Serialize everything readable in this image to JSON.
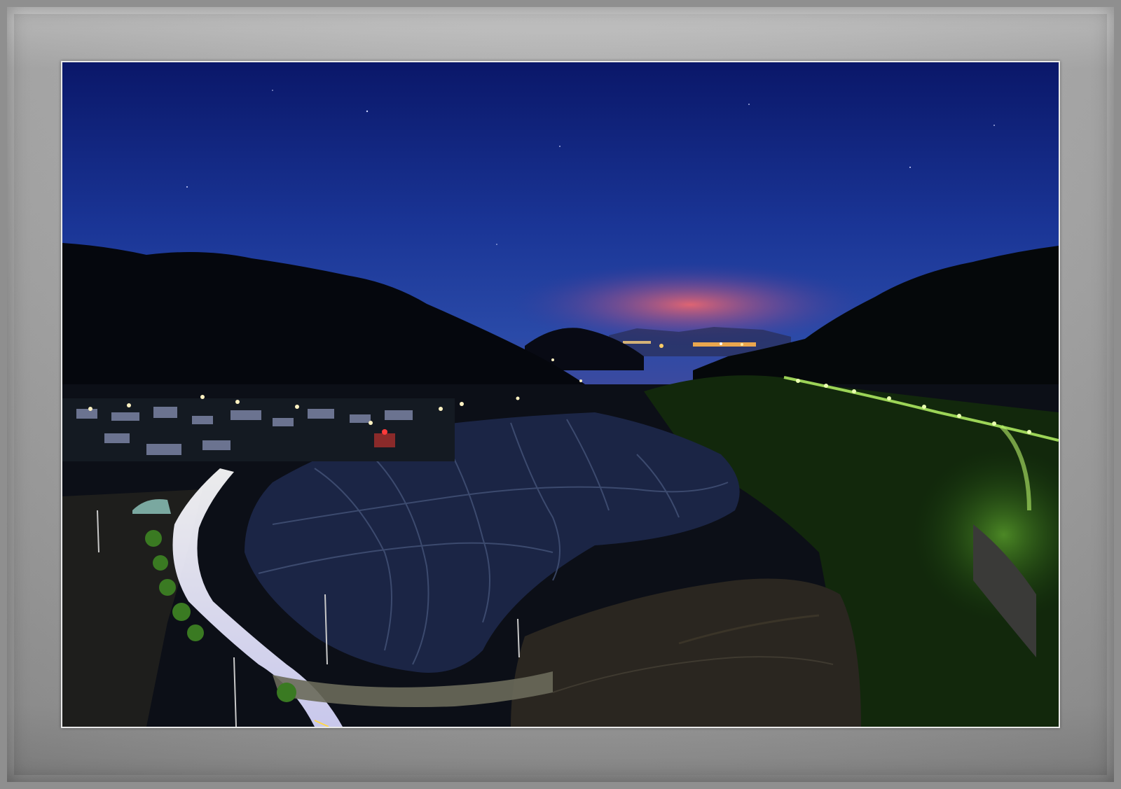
{
  "frame": {
    "outer_color": "#8f8f8f",
    "mat_color": "#a8a8a8",
    "border_color": "#e9e9e9"
  },
  "photo": {
    "sky_top": "#0b1a6e",
    "sky_mid": "#1d3d9e",
    "sky_horizon": "#6a5a9a",
    "glow_color": "#ff7a7a",
    "mountain_color": "#05070d",
    "field_color": "#1b2540",
    "road_light_color": "#f1f0ff",
    "foliage_color": "#3a8a2a",
    "street_light_color": "#c8ff5a"
  }
}
